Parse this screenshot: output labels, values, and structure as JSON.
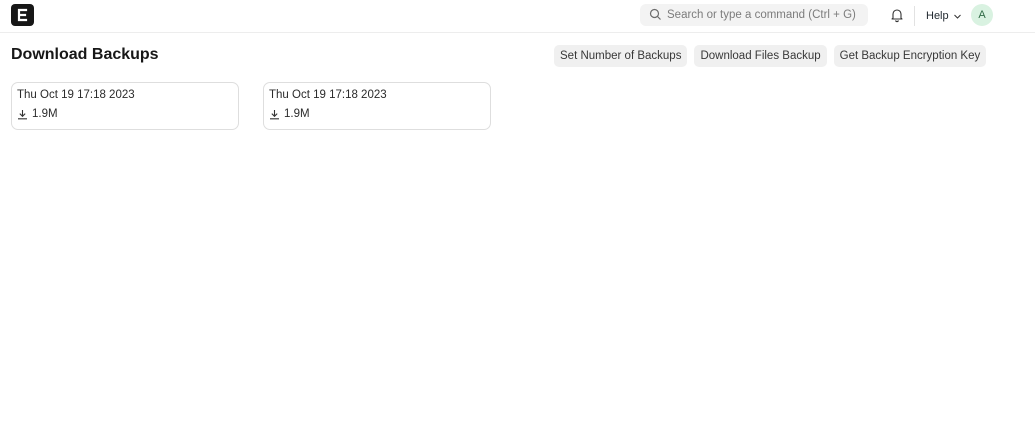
{
  "navbar": {
    "logo_letter": "E",
    "search_placeholder": "Search or type a command (Ctrl + G)",
    "help_label": "Help",
    "avatar_initial": "A"
  },
  "page": {
    "title": "Download Backups"
  },
  "actions": {
    "set_number_label": "Set Number of Backups",
    "download_files_label": "Download Files Backup",
    "encryption_key_label": "Get Backup Encryption Key"
  },
  "backups": [
    {
      "date": "Thu Oct 19 17:18 2023",
      "size": "1.9M"
    },
    {
      "date": "Thu Oct 19 17:18 2023",
      "size": "1.9M"
    }
  ],
  "colors": {
    "logo_bg": "#171717",
    "avatar_bg": "#d9f2e1",
    "button_bg": "#f0f0f0"
  },
  "icons": [
    "erpnext-logo-icon",
    "search-icon",
    "bell-icon",
    "chevron-down-icon",
    "download-icon"
  ]
}
